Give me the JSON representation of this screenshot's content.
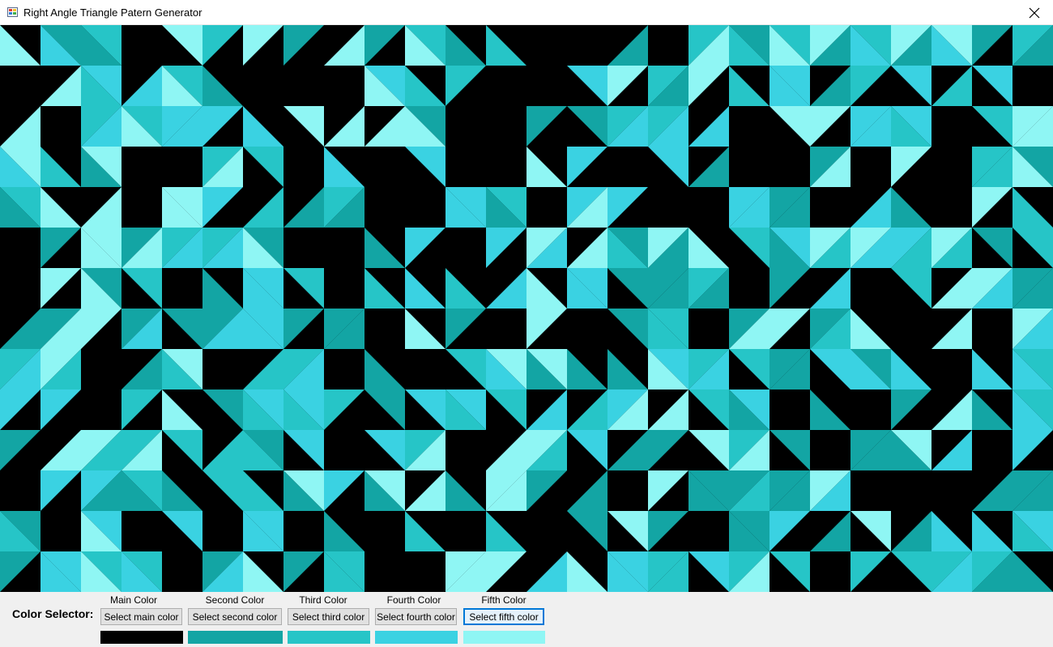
{
  "window": {
    "title": "Right Angle Triangle Patern Generator"
  },
  "icons": {
    "app": "app-icon",
    "close": "close-icon"
  },
  "panel": {
    "selector_label": "Color Selector:",
    "columns": [
      {
        "label": "Main Color",
        "button": "Select main color",
        "color": "#000000"
      },
      {
        "label": "Second Color",
        "button": "Select second color",
        "color": "#13a5a4"
      },
      {
        "label": "Third Color",
        "button": "Select third color",
        "color": "#26c5c7"
      },
      {
        "label": "Fourth Color",
        "button": "Select fourth color",
        "color": "#3ad2e2"
      },
      {
        "label": "Fifth Color",
        "button": "Select fifth color",
        "color": "#8ff6f4"
      }
    ],
    "focused_button": 4
  }
}
